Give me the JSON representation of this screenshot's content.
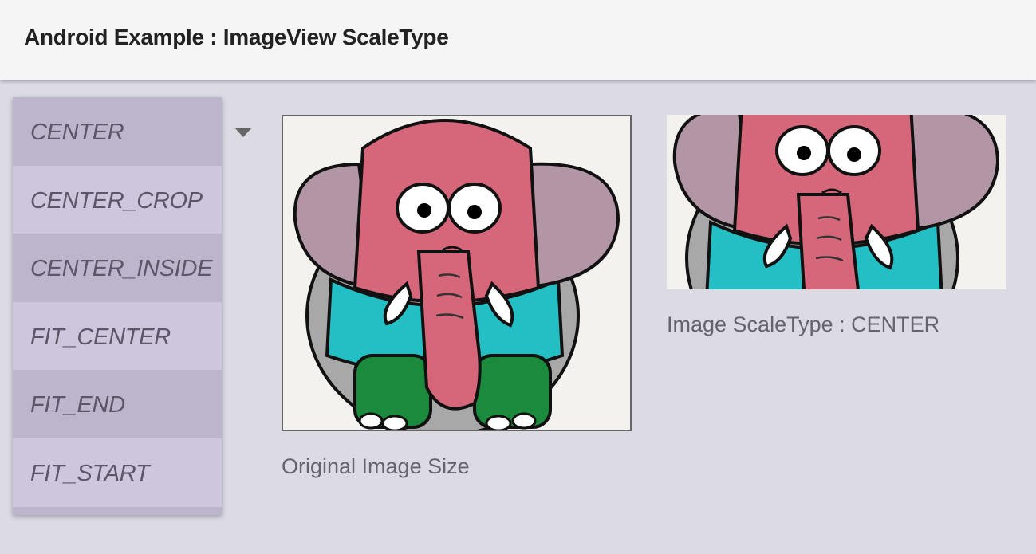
{
  "appbar": {
    "title": "Android Example : ImageView ScaleType"
  },
  "dropdown": {
    "options": [
      {
        "label": "CENTER"
      },
      {
        "label": "CENTER_CROP"
      },
      {
        "label": "CENTER_INSIDE"
      },
      {
        "label": "FIT_CENTER"
      },
      {
        "label": "FIT_END"
      },
      {
        "label": "FIT_START"
      }
    ],
    "arrow_icon": "arrow-drop-down-icon"
  },
  "images": {
    "original_caption": "Original Image Size",
    "scaled_caption": "Image ScaleType : CENTER",
    "picture_subject": "elephant-illustration"
  },
  "colors": {
    "background": "#dcdae3",
    "appbar": "#f5f5f5",
    "dropdown_item": "#cdc6dc",
    "dropdown_item_alt": "#bdb5cb",
    "elephant_head": "#d6677b",
    "elephant_ears": "#b296a6",
    "elephant_body": "#23bfc4",
    "elephant_feet": "#1a8a3d"
  }
}
